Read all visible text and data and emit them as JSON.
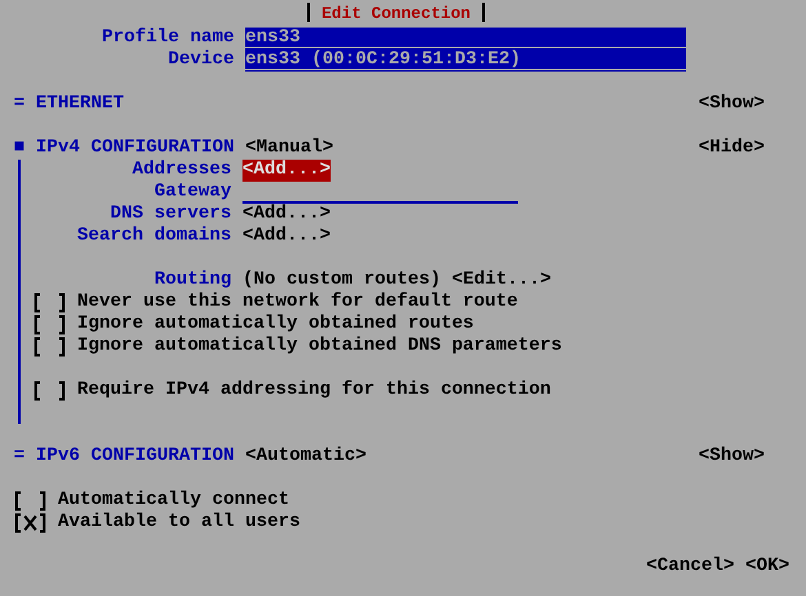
{
  "title": "Edit Connection",
  "fields": [
    {
      "label": "Profile name",
      "value": "ens33"
    },
    {
      "label": "Device",
      "value": "ens33 (00:0C:29:51:D3:E2)"
    }
  ],
  "ethernet": {
    "marker": "=",
    "title": "ETHERNET",
    "toggle": "<Show>"
  },
  "ipv4": {
    "marker": "■",
    "title": "IPv4 CONFIGURATION",
    "mode": "<Manual>",
    "toggle": "<Hide>",
    "expanded": true,
    "rows": [
      {
        "kind": "button",
        "label": "Addresses",
        "button": "<Add...>",
        "selected": true
      },
      {
        "kind": "input",
        "label": "Gateway"
      },
      {
        "kind": "button",
        "label": "DNS servers",
        "button": "<Add...>",
        "selected": false
      },
      {
        "kind": "button",
        "label": "Search domains",
        "button": "<Add...>",
        "selected": false
      },
      {
        "kind": "spacer"
      },
      {
        "kind": "routing",
        "label": "Routing",
        "text": "(No custom routes)",
        "button": "<Edit...>",
        "selected": false
      },
      {
        "kind": "checkbox",
        "label": "Never use this network for default route",
        "checked": false
      },
      {
        "kind": "checkbox",
        "label": "Ignore automatically obtained routes",
        "checked": false
      },
      {
        "kind": "checkbox",
        "label": "Ignore automatically obtained DNS parameters",
        "checked": false
      },
      {
        "kind": "spacer"
      },
      {
        "kind": "checkbox",
        "label": "Require IPv4 addressing for this connection",
        "checked": false
      },
      {
        "kind": "spacer"
      }
    ]
  },
  "ipv6": {
    "marker": "=",
    "title": "IPv6 CONFIGURATION",
    "mode": "<Automatic>",
    "toggle": "<Show>"
  },
  "options": [
    {
      "label": "Automatically connect",
      "checked": false
    },
    {
      "label": "Available to all users",
      "checked": true
    }
  ],
  "buttons": [
    {
      "label": "<Cancel>",
      "selected": false
    },
    {
      "label": "<OK>",
      "selected": false
    }
  ]
}
